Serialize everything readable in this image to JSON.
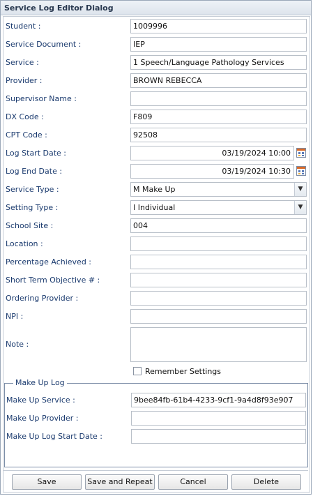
{
  "window": {
    "title": "Service Log Editor Dialog"
  },
  "fields": [
    {
      "label": "Student :",
      "value": "1009996"
    },
    {
      "label": "Service Document :",
      "value": "IEP"
    },
    {
      "label": "Service :",
      "value": "1 Speech/Language Pathology Services"
    },
    {
      "label": "Provider :",
      "value": "BROWN REBECCA"
    },
    {
      "label": "Supervisor Name :",
      "value": ""
    },
    {
      "label": "DX Code :",
      "value": "F809"
    },
    {
      "label": "CPT Code :",
      "value": "92508"
    },
    {
      "label": "Log Start Date :",
      "value": "03/19/2024 10:00"
    },
    {
      "label": "Log End Date :",
      "value": "03/19/2024 10:30"
    },
    {
      "label": "Service Type :",
      "value": "M Make Up"
    },
    {
      "label": "Setting Type :",
      "value": "I Individual"
    },
    {
      "label": "School Site :",
      "value": "004"
    },
    {
      "label": "Location :",
      "value": ""
    },
    {
      "label": "Percentage Achieved :",
      "value": ""
    },
    {
      "label": "Short Term Objective # :",
      "value": ""
    },
    {
      "label": "Ordering Provider :",
      "value": ""
    },
    {
      "label": "NPI :",
      "value": ""
    },
    {
      "label": "Note :",
      "value": ""
    }
  ],
  "remember": {
    "label": "Remember Settings",
    "checked": false
  },
  "makeup": {
    "legend": "Make Up Log",
    "rows": [
      {
        "label": "Make Up Service :",
        "value": "9bee84fb-61b4-4233-9cf1-9a4d8f93e907"
      },
      {
        "label": "Make Up Provider :",
        "value": ""
      },
      {
        "label": "Make Up Log Start Date :",
        "value": ""
      }
    ]
  },
  "buttons": {
    "save": "Save",
    "save_repeat": "Save and Repeat",
    "cancel": "Cancel",
    "delete": "Delete"
  },
  "icons": {
    "calendar": "calendar-icon",
    "dropdown": "chevron-down-icon"
  }
}
